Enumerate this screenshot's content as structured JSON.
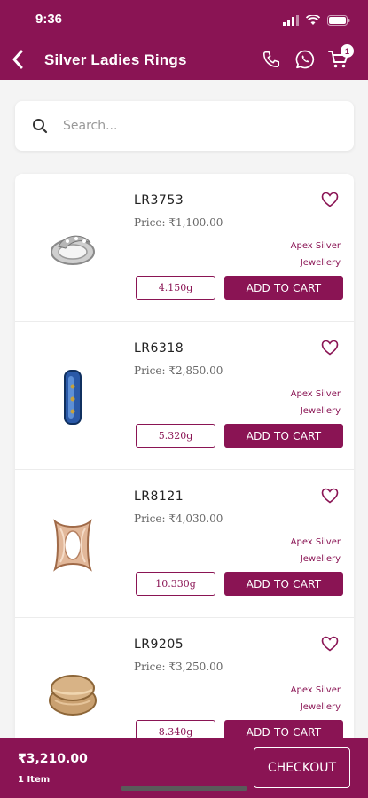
{
  "status_bar": {
    "time": "9:36",
    "icons": [
      "signal-icon",
      "wifi-icon",
      "battery-icon"
    ]
  },
  "header": {
    "title": "Silver Ladies Rings",
    "actions": [
      "phone-icon",
      "whatsapp-icon",
      "cart-icon"
    ],
    "cart_badge": "1"
  },
  "search": {
    "placeholder": "Search..."
  },
  "colors": {
    "accent": "#8a1454",
    "background": "#f4f4f4"
  },
  "products": [
    {
      "code": "LR3753",
      "price": "Price: ₹1,100.00",
      "brand_line1": "Apex Silver",
      "brand_line2": "Jewellery",
      "weight": "4.150g",
      "add_label": "ADD TO CART",
      "image": "silver-ring-image"
    },
    {
      "code": "LR6318",
      "price": "Price: ₹2,850.00",
      "brand_line1": "Apex Silver",
      "brand_line2": "Jewellery",
      "weight": "5.320g",
      "add_label": "ADD TO CART",
      "image": "blue-band-ring-image"
    },
    {
      "code": "LR8121",
      "price": "Price: ₹4,030.00",
      "brand_line1": "Apex Silver",
      "brand_line2": "Jewellery",
      "weight": "10.330g",
      "add_label": "ADD TO CART",
      "image": "rose-gold-ring-image"
    },
    {
      "code": "LR9205",
      "price": "Price: ₹3,250.00",
      "brand_line1": "Apex Silver",
      "brand_line2": "Jewellery",
      "weight": "8.340g",
      "add_label": "ADD TO CART",
      "image": "gold-wave-ring-image"
    }
  ],
  "footer": {
    "total": "₹3,210.00",
    "items": "1 Item",
    "checkout_label": "CHECKOUT"
  }
}
